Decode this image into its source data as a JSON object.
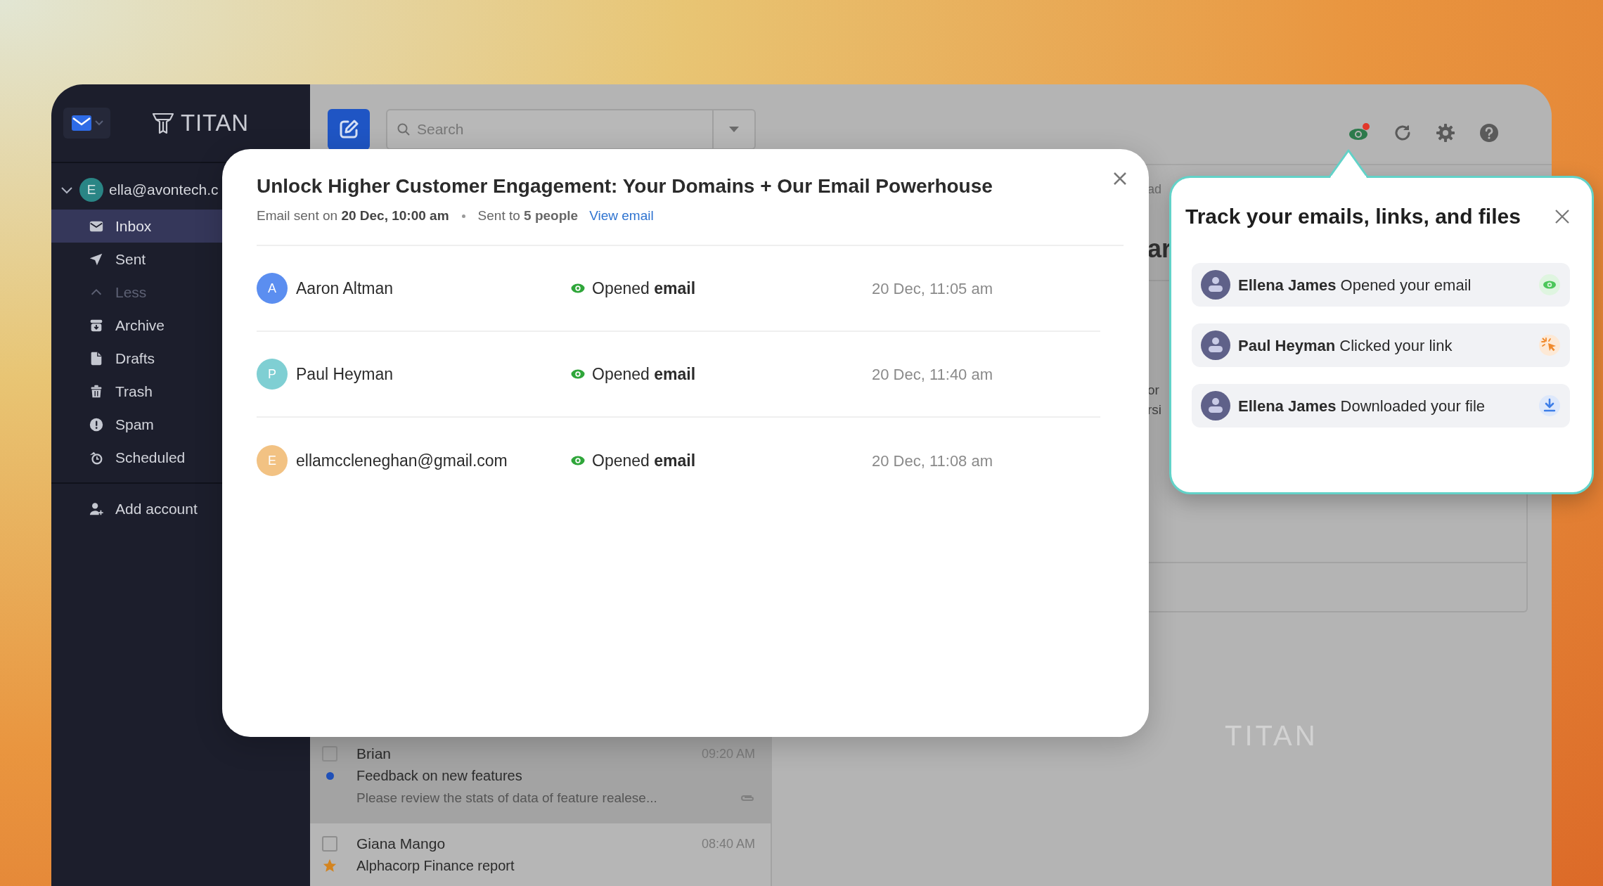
{
  "sidebar": {
    "logo": "TITAN",
    "account": {
      "initial": "E",
      "email": "ella@avontech.c",
      "expanded": true
    },
    "folders": [
      {
        "kind": "inbox",
        "label": "Inbox",
        "selected": true
      },
      {
        "kind": "sent",
        "label": "Sent",
        "selected": false
      },
      {
        "kind": "less",
        "label": "Less",
        "selected": false
      },
      {
        "kind": "archive",
        "label": "Archive",
        "selected": false
      },
      {
        "kind": "drafts",
        "label": "Drafts",
        "selected": false
      },
      {
        "kind": "trash",
        "label": "Trash",
        "selected": false
      },
      {
        "kind": "spam",
        "label": "Spam",
        "selected": false
      },
      {
        "kind": "scheduled",
        "label": "Scheduled",
        "selected": false
      }
    ],
    "add_account": "Add account"
  },
  "toolbar": {
    "search": {
      "placeholder": "Search"
    },
    "tracking_unread": true
  },
  "email_list": [
    {
      "sender": "Brian",
      "time": "09:20 AM",
      "subject": "Feedback on new features",
      "preview": "Please review the stats of data of feature realese...",
      "unread": true,
      "starred": false,
      "attachment": true,
      "selected": true
    },
    {
      "sender": "Giana Mango",
      "time": "08:40 AM",
      "subject": "Alphacorp Finance report",
      "unread": false,
      "starred": true,
      "attachment": false,
      "selected": false
    }
  ],
  "reading_pane": {
    "fragments": [
      "ad",
      "ar",
      "or",
      "rsi"
    ],
    "logo": "TITAN"
  },
  "tracking_modal": {
    "title": "Unlock Higher Customer Engagement: Your Domains + Our Email Powerhouse",
    "sent": "Email sent on **20 Dec, 10:00 am**",
    "recipients": "Sent to **5 people**",
    "link": "View email",
    "rows": [
      {
        "initial": "A",
        "name": "Aaron Altman",
        "color": "#5b8ef0",
        "status": "Opened **email**",
        "time": "20 Dec, 11:05 am"
      },
      {
        "initial": "P",
        "name": "Paul Heyman",
        "color": "#7fcfd3",
        "status": "Opened **email**",
        "time": "20 Dec, 11:40 am"
      },
      {
        "initial": "E",
        "name": "ellamccleneghan@gmail.com",
        "color": "#f2c283",
        "status": "Opened **email**",
        "time": "20 Dec, 11:08 am"
      }
    ]
  },
  "tracking_popover": {
    "title": "Track your emails, links, and files",
    "items": [
      {
        "kind": "opened",
        "text": "**Ellena James** Opened your email"
      },
      {
        "kind": "clicked",
        "text": "**Paul Heyman** Clicked your link"
      },
      {
        "kind": "downloaded",
        "text": "**Ellena James** Downloaded your file"
      }
    ]
  }
}
